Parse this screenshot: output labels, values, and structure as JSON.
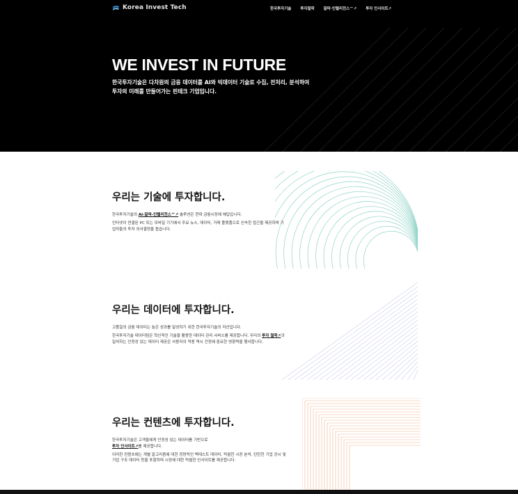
{
  "brand": {
    "name": "Korea Invest Tech",
    "logo_icon": "wave-logo-icon"
  },
  "nav": {
    "items": [
      "한국투자기술",
      "투자철학",
      "알파·인텔리전스™↗",
      "투자 인사이트↗"
    ]
  },
  "hero": {
    "title": "WE INVEST IN FUTURE",
    "subtitle_line1": "한국투자기술은 다차원의 금융 데이터를 AI와 빅데이터 기술로 수집, 전처리, 분석하여",
    "subtitle_line2": "투자의 미래를 만들어가는 핀테크 기업입니다."
  },
  "sections": [
    {
      "title": "우리는 기술에 투자합니다.",
      "p1_pre": "한국투자기술의 ",
      "p1_link": "AI-알파-인텔리전스™↗",
      "p1_post": " 솔루션은 현대 금융시장에 해답입니다.",
      "p2": "인터넷이 연결된 PC 또는 모바일 기기에서 주요 뉴스, 데이터, 거래 플랫폼으로 신속한 접근을 제공하며 기업자들의 투자 의사결정을 돕습니다."
    },
    {
      "title": "우리는 데이터에 투자합니다.",
      "p1": "고품질의 금융 데이터는 높은 성과를 달성하기 위한 한국투자기술의 자산입니다.",
      "p2_pre": "한국투자기술 데이터팀은 혁신적인 기술을 활용한 데이터 관리 서비스를 제공합니다. 우리의 ",
      "p2_link": "투자 철학↗",
      "p2_post": "과 일치하는 안정성 있는 데이터 제공은 사용자의 적용 역시 건정에 중요한 영향력을 행사합니다."
    },
    {
      "title": "우리는 컨텐츠에 투자합니다.",
      "p1": "한국투자기술은 고객들에게 안정성 있는 데이터를 기반으로",
      "p1_link": "투자 인사이트↗",
      "p1_post": "를 제공합니다.",
      "p2": "이러한 컨텐츠에는 개별 알고리즘에 대한 정량적인 백테스트 데이터, 탁월한 시장 분석, 탄탄한 기업 공시 및 기업 구조 데이터 등을 포함하며 시장에 대한 탁월한 인사이트를 제공합니다."
    }
  ],
  "colors": {
    "hero_bg": "#000000",
    "teal_line": "#8fd3c7",
    "orange_line": "#f2b48a"
  }
}
